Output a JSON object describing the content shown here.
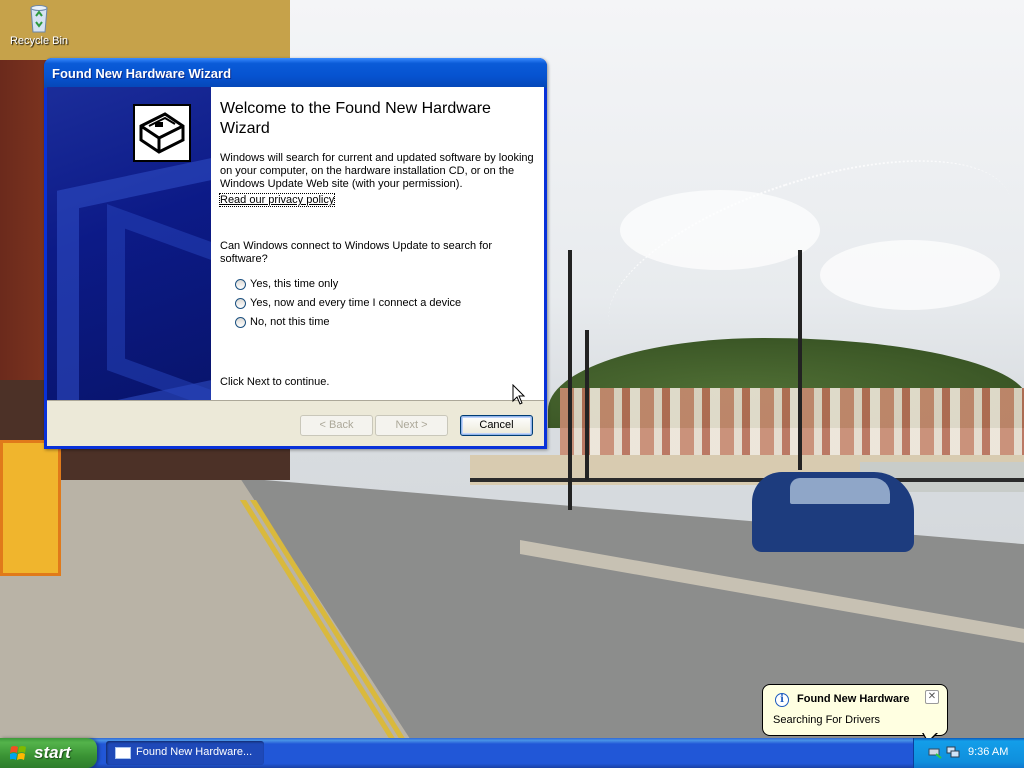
{
  "desktop": {
    "icons": [
      {
        "label": "Recycle Bin",
        "icon": "recycle-bin-icon"
      }
    ]
  },
  "wizard": {
    "window_title": "Found New Hardware Wizard",
    "heading": "Welcome to the Found New Hardware Wizard",
    "intro_text": "Windows will search for current and updated software by looking on your computer, on the hardware installation CD, or on the Windows Update Web site (with your permission).",
    "privacy_link": "Read our privacy policy",
    "question": "Can Windows connect to Windows Update to search for software?",
    "options": [
      {
        "label": "Yes, this time only",
        "selected": false
      },
      {
        "label": "Yes, now and every time I connect a device",
        "selected": false
      },
      {
        "label": "No, not this time",
        "selected": false
      }
    ],
    "footer_text": "Click Next to continue.",
    "buttons": {
      "back": "< Back",
      "next": "Next >",
      "cancel": "Cancel"
    },
    "icon": "hardware-card-icon"
  },
  "balloon": {
    "title": "Found New Hardware",
    "text": "Searching For Drivers",
    "icon": "info-icon",
    "close": "✕"
  },
  "taskbar": {
    "start_label": "start",
    "tasks": [
      {
        "label": "Found New Hardware...",
        "active": true
      }
    ],
    "clock": "9:36 AM"
  },
  "colors": {
    "titlebar": "#0653d0",
    "taskbar": "#2157d7",
    "start_button": "#3a9334",
    "balloon_bg": "#ffffe1"
  }
}
